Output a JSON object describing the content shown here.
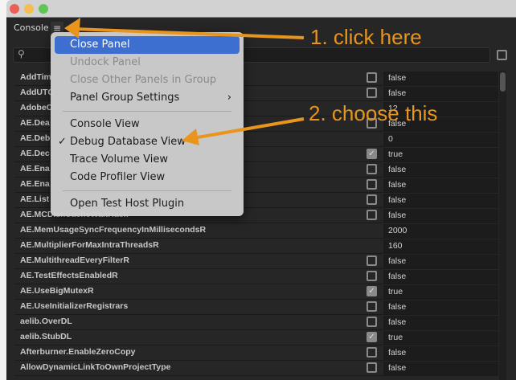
{
  "panel": {
    "title": "Console",
    "menu_icon": "hamburger-icon",
    "search_icon": "magnifier-icon",
    "search_placeholder": ""
  },
  "menu": {
    "items": [
      {
        "label": "Close Panel",
        "state": "highlighted"
      },
      {
        "label": "Undock Panel",
        "state": "disabled"
      },
      {
        "label": "Close Other Panels in Group",
        "state": "disabled"
      },
      {
        "label": "Panel Group Settings",
        "state": "submenu"
      },
      {
        "label": "Console View"
      },
      {
        "label": "Debug Database View",
        "checked": true
      },
      {
        "label": "Trace Volume View"
      },
      {
        "label": "Code Profiler View"
      },
      {
        "label": "Open Test Host Plugin"
      }
    ],
    "check_glyph": "✓",
    "submenu_glyph": "›"
  },
  "rows": [
    {
      "name": "AddTim",
      "checkbox": true,
      "checked": false,
      "value": "false"
    },
    {
      "name": "AddUTC",
      "checkbox": true,
      "checked": false,
      "value": "false"
    },
    {
      "name": "AdobeC",
      "checkbox": false,
      "value": "12"
    },
    {
      "name": "AE.Dea",
      "checkbox": true,
      "checked": false,
      "value": "false"
    },
    {
      "name": "AE.Deb",
      "checkbox": false,
      "value": "0"
    },
    {
      "name": "AE.Dec",
      "checkbox": true,
      "checked": true,
      "value": "true"
    },
    {
      "name": "AE.Ena",
      "checkbox": true,
      "checked": false,
      "value": "false"
    },
    {
      "name": "AE.Ena",
      "checkbox": true,
      "checked": false,
      "value": "false"
    },
    {
      "name": "AE.List",
      "checkbox": true,
      "checked": false,
      "value": "false"
    },
    {
      "name": "AE.MCDiskCacheWaitHack",
      "checkbox": true,
      "checked": false,
      "value": "false"
    },
    {
      "name": "AE.MemUsageSyncFrequencyInMillisecondsR",
      "checkbox": false,
      "value": "2000"
    },
    {
      "name": "AE.MultiplierForMaxIntraThreadsR",
      "checkbox": false,
      "value": "160"
    },
    {
      "name": "AE.MultithreadEveryFilterR",
      "checkbox": true,
      "checked": false,
      "value": "false"
    },
    {
      "name": "AE.TestEffectsEnabledR",
      "checkbox": true,
      "checked": false,
      "value": "false"
    },
    {
      "name": "AE.UseBigMutexR",
      "checkbox": true,
      "checked": true,
      "value": "true"
    },
    {
      "name": "AE.UseInitializerRegistrars",
      "checkbox": true,
      "checked": false,
      "value": "false"
    },
    {
      "name": "aelib.OverDL",
      "checkbox": true,
      "checked": false,
      "value": "false"
    },
    {
      "name": "aelib.StubDL",
      "checkbox": true,
      "checked": true,
      "value": "true"
    },
    {
      "name": "Afterburner.EnableZeroCopy",
      "checkbox": true,
      "checked": false,
      "value": "false"
    },
    {
      "name": "AllowDynamicLinkToOwnProjectType",
      "checkbox": true,
      "checked": false,
      "value": "false"
    }
  ],
  "annotations": {
    "step1": "1. click here",
    "step2": "2. choose this",
    "color": "#e8951e"
  }
}
